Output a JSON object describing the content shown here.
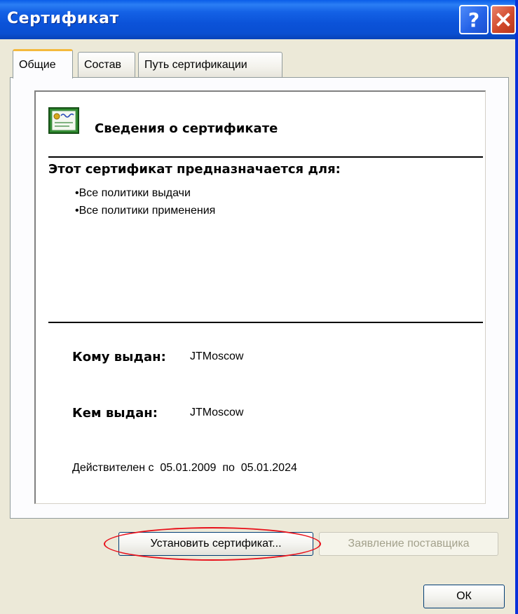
{
  "window": {
    "title": "Сертификат",
    "help_glyph": "?",
    "close_glyph": "✕"
  },
  "tabs": [
    {
      "label": "Общие"
    },
    {
      "label": "Состав"
    },
    {
      "label": "Путь сертификации"
    }
  ],
  "info": {
    "header": "Сведения о сертификате",
    "purpose_title": "Этот сертификат предназначается для:",
    "purposes": [
      "Все политики выдачи",
      "Все политики применения"
    ],
    "issued_to_label": "Кому выдан:",
    "issued_to_value": "JTMoscow",
    "issued_by_label": "Кем выдан:",
    "issued_by_value": "JTMoscow",
    "validity": "Действителен с  05.01.2009  по  05.01.2024"
  },
  "buttons": {
    "install": "Установить сертификат...",
    "issuer_statement": "Заявление поставщика",
    "ok": "ОК"
  },
  "colors": {
    "titlebar": "#0a52d8",
    "face": "#ece9d8",
    "highlight": "#e8101a",
    "active_tab_accent": "#f4b93d"
  },
  "icons": {
    "help": "help-icon",
    "close": "close-icon",
    "certificate": "certificate-icon"
  }
}
